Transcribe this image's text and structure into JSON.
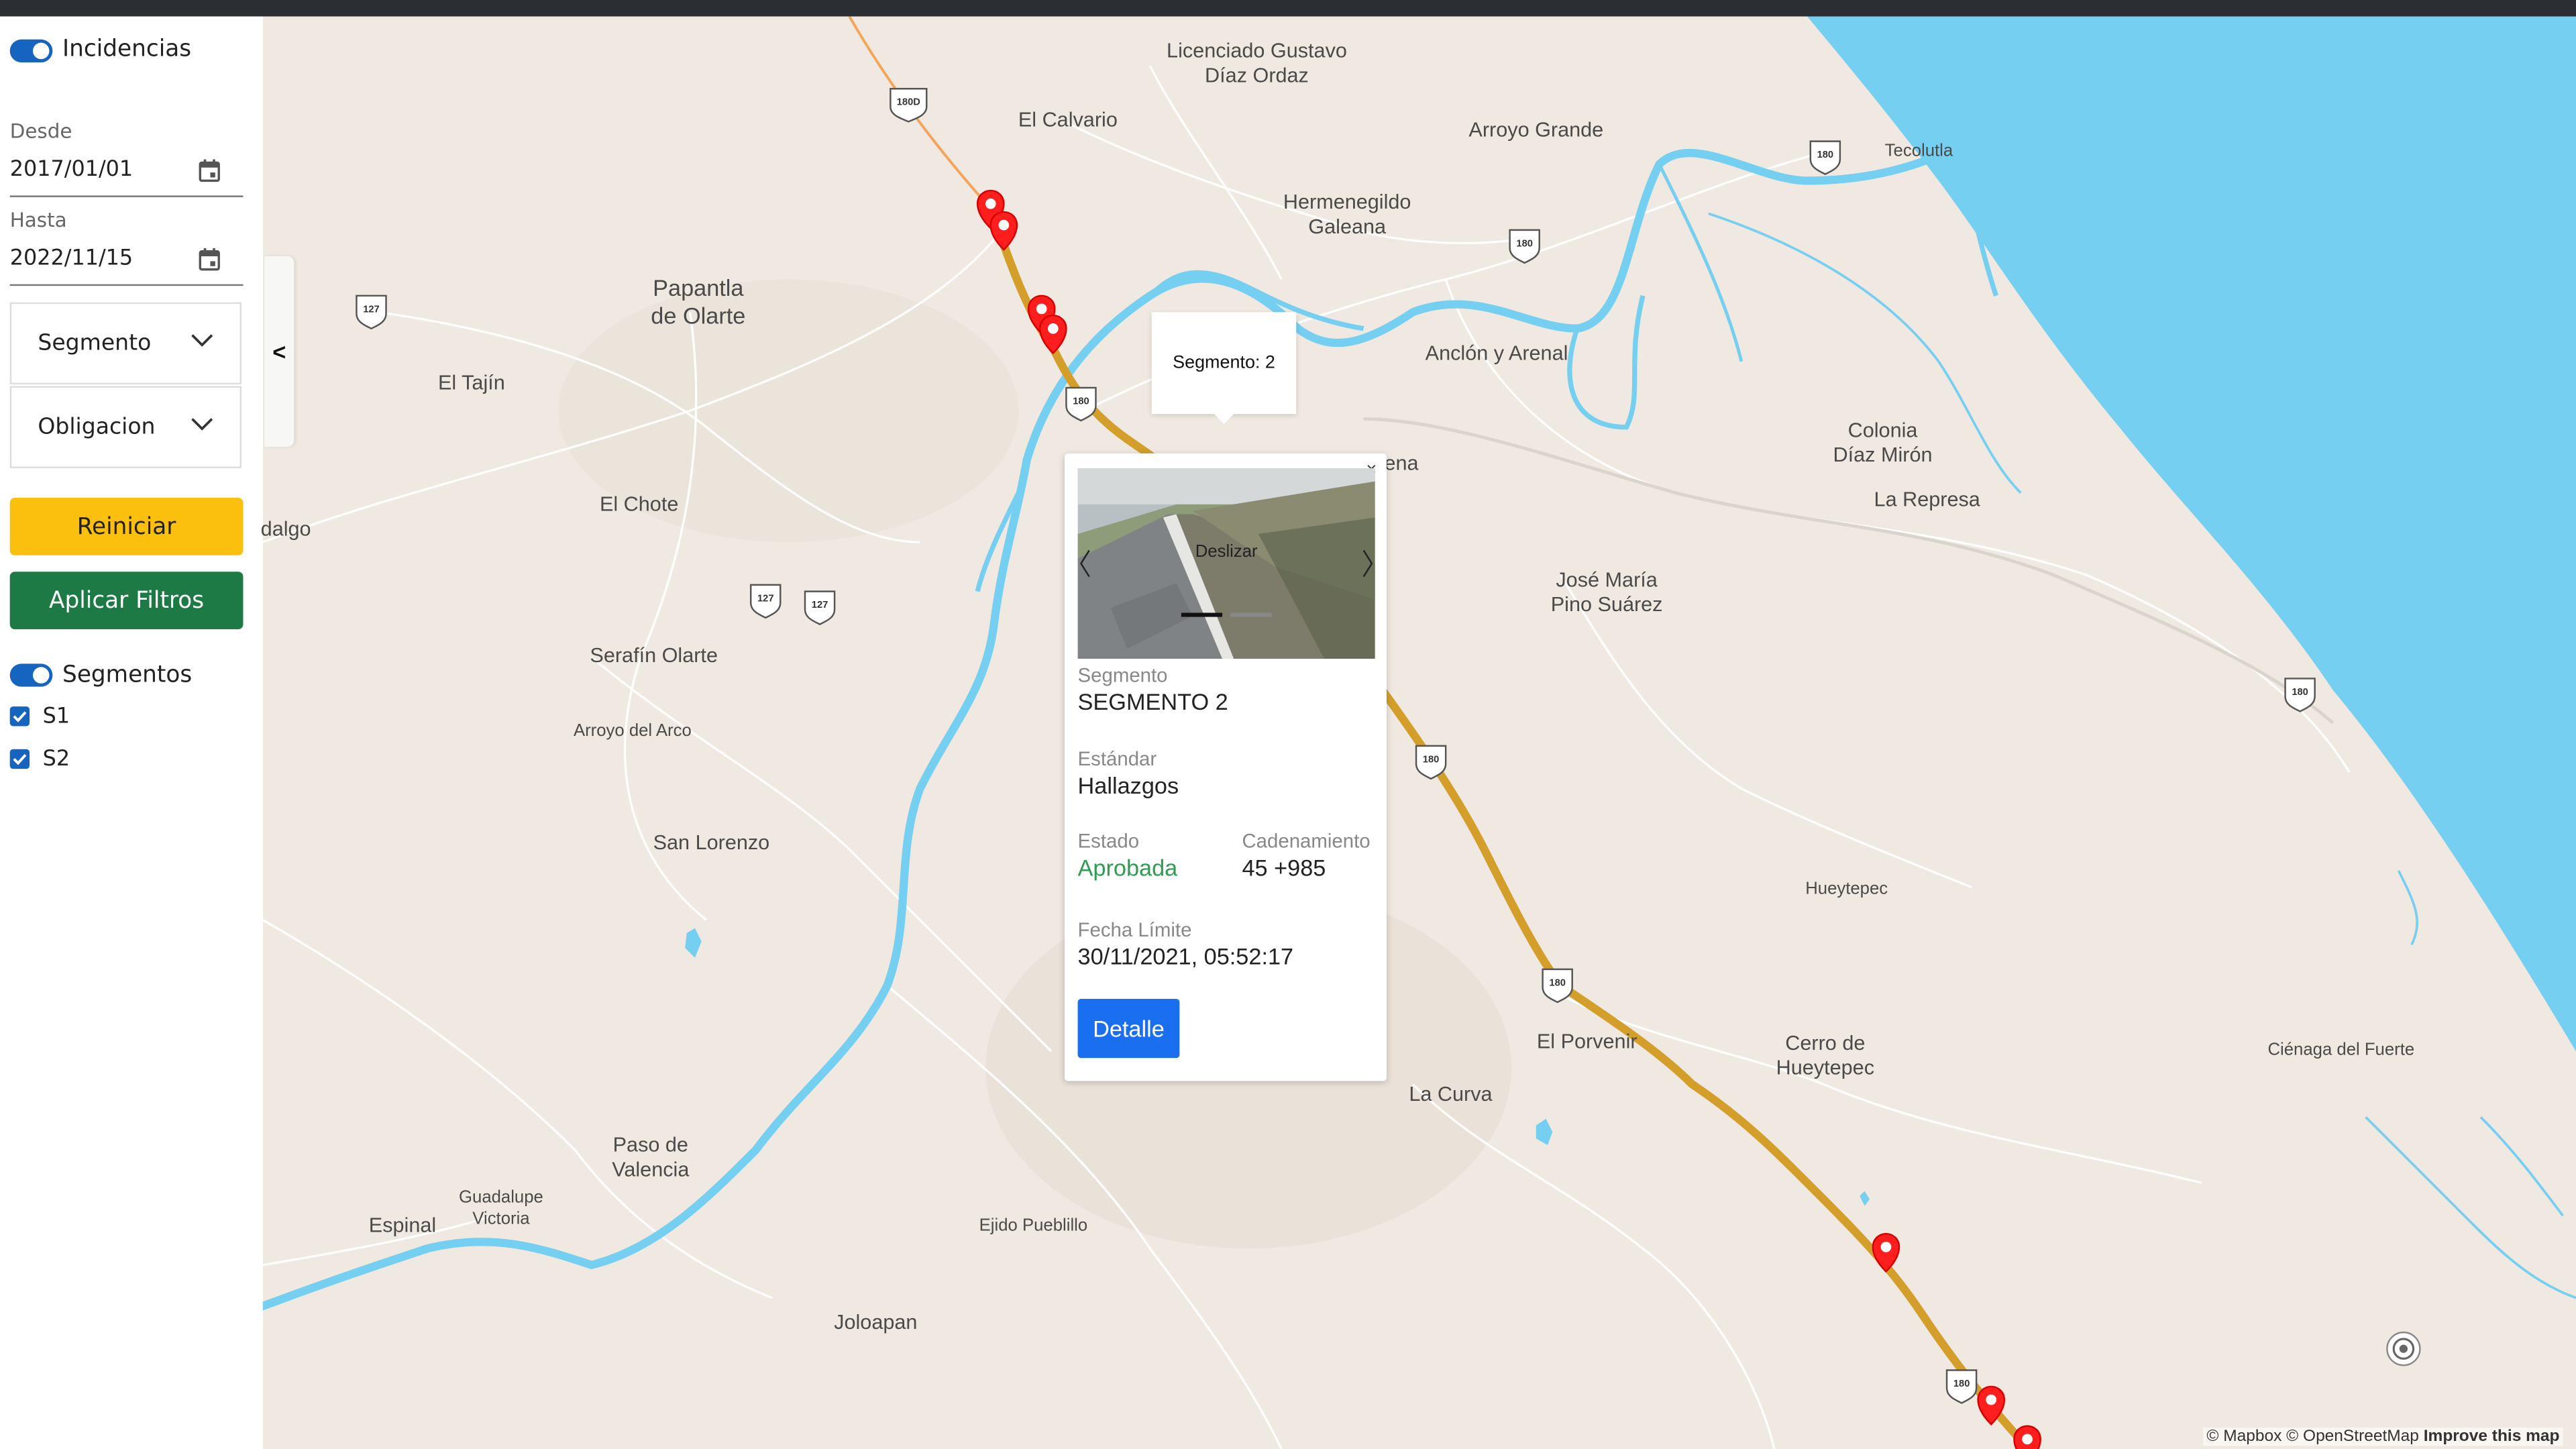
{
  "sidebar": {
    "incidencias_label": "Incidencias",
    "desde_label": "Desde",
    "desde_value": "2017/01/01",
    "hasta_label": "Hasta",
    "hasta_value": "2022/11/15",
    "segmento_select": "Segmento",
    "obligacion_select": "Obligacion",
    "reiniciar_label": "Reiniciar",
    "aplicar_label": "Aplicar Filtros",
    "segmentos_label": "Segmentos",
    "segments": [
      {
        "label": "S1",
        "checked": true
      },
      {
        "label": "S2",
        "checked": true
      }
    ],
    "collapse_glyph": "<"
  },
  "map": {
    "tooltip": "Segmento: 2",
    "places": [
      {
        "name": "Licenciado Gustavo\nDíaz Ordaz"
      },
      {
        "name": "El Calvario"
      },
      {
        "name": "Arroyo Grande"
      },
      {
        "name": "Tecolutla"
      },
      {
        "name": "Hermenegildo\nGaleana"
      },
      {
        "name": "Papantla\nde Olarte"
      },
      {
        "name": "El Tajín"
      },
      {
        "name": "Anclón y Arenal"
      },
      {
        "name": "Colonia\nDíaz Mirón"
      },
      {
        "name": "La Represa"
      },
      {
        "name": "El Chote"
      },
      {
        "name": "ena"
      },
      {
        "name": "dalgo"
      },
      {
        "name": "José María\nPino Suárez"
      },
      {
        "name": "Serafín Olarte"
      },
      {
        "name": "Arroyo del Arco"
      },
      {
        "name": "San Lorenzo"
      },
      {
        "name": "Hueytepec"
      },
      {
        "name": "El Porvenir"
      },
      {
        "name": "Cerro de\nHueytepec"
      },
      {
        "name": "Ciénaga del Fuerte"
      },
      {
        "name": "La Curva"
      },
      {
        "name": "Paso de\nValencia"
      },
      {
        "name": "Guadalupe\nVictoria"
      },
      {
        "name": "Espinal"
      },
      {
        "name": "Ejido Pueblillo"
      },
      {
        "name": "Joloapan"
      }
    ],
    "shields": [
      "180D",
      "180",
      "180",
      "127",
      "127",
      "127",
      "180",
      "180",
      "180",
      "180",
      "180"
    ],
    "attribution": "© Mapbox © OpenStreetMap",
    "improve": "Improve this map"
  },
  "popup": {
    "close": "×",
    "photo_caption": "Deslizar",
    "segmento_label": "Segmento",
    "segmento_value": "SEGMENTO 2",
    "estandar_label": "Estándar",
    "estandar_value": "Hallazgos",
    "estado_label": "Estado",
    "estado_value": "Aprobada",
    "cadenamiento_label": "Cadenamiento",
    "cadenamiento_value": "45 +985",
    "fecha_label": "Fecha Límite",
    "fecha_value": "30/11/2021, 05:52:17",
    "detalle_label": "Detalle"
  }
}
